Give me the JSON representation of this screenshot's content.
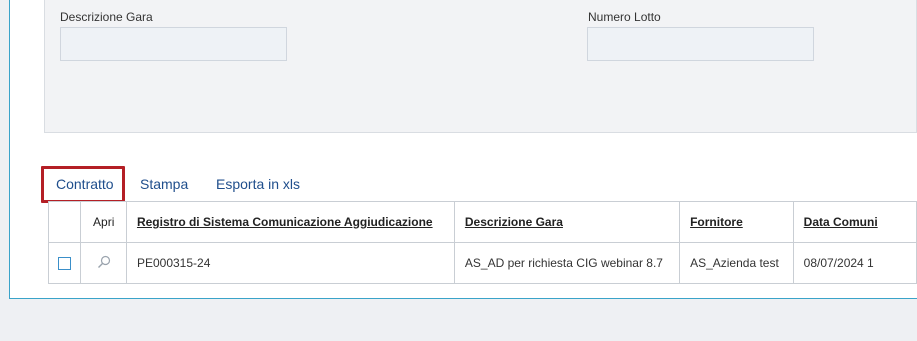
{
  "filters": {
    "descrizione_label": "Descrizione Gara",
    "descrizione_value": "",
    "numero_lotto_label": "Numero Lotto",
    "numero_lotto_value": ""
  },
  "toolbar": {
    "contratto": "Contratto",
    "stampa": "Stampa",
    "esporta": "Esporta in xls"
  },
  "table": {
    "headers": {
      "apri": "Apri",
      "registro": "Registro di Sistema Comunicazione Aggiudicazione",
      "descrizione": "Descrizione Gara",
      "fornitore": "Fornitore",
      "data": "Data Comuni"
    },
    "rows": [
      {
        "registro": "PE000315-24",
        "descrizione": "AS_AD per richiesta CIG webinar 8.7",
        "fornitore": "AS_Azienda test",
        "data": "08/07/2024 1"
      }
    ]
  },
  "colors": {
    "accent": "#1f4e8c",
    "highlight": "#b41f25",
    "border": "#3aa3c9"
  },
  "icons": {
    "apri": "search-icon"
  }
}
